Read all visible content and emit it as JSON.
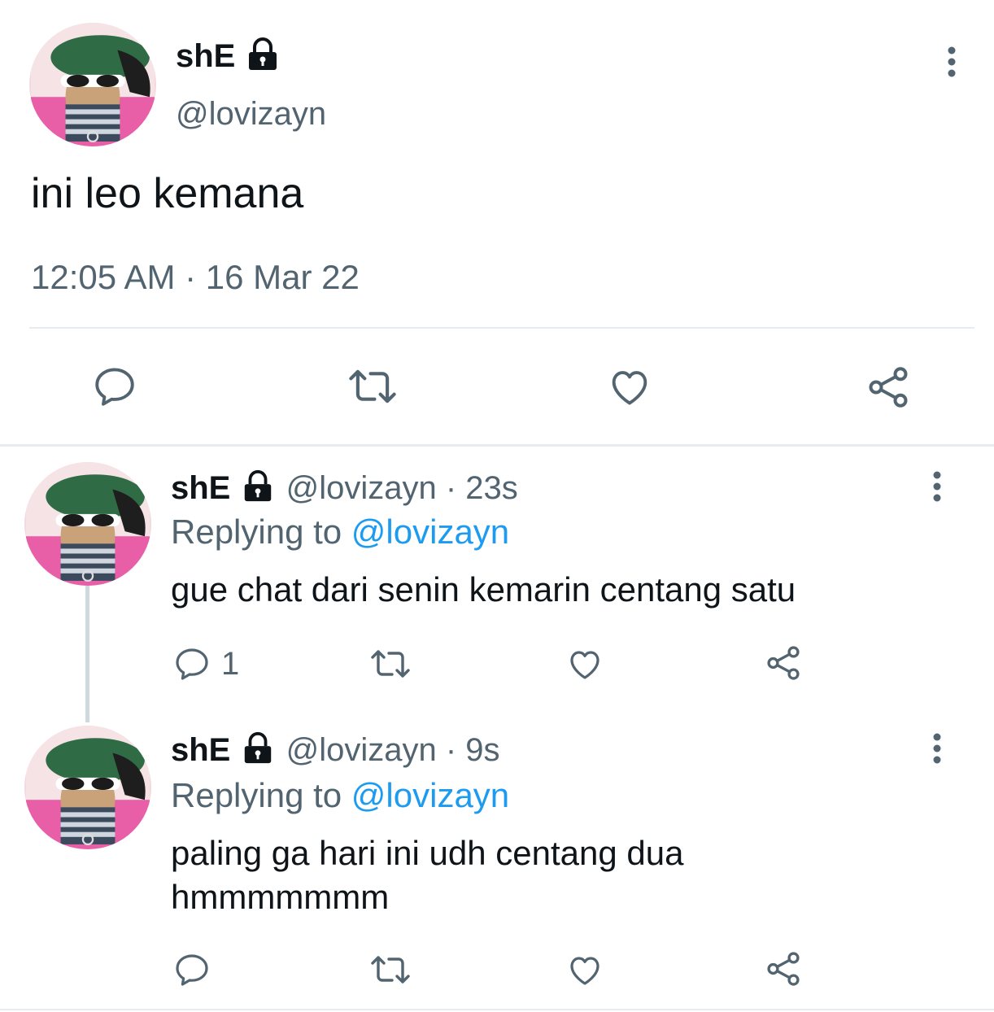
{
  "main_tweet": {
    "display_name": "shE",
    "handle": "@lovizayn",
    "text": "ini leo kemana",
    "timestamp": "12:05 AM · 16 Mar 22",
    "actions": [
      "reply-icon",
      "retweet-icon",
      "like-icon",
      "share-icon"
    ]
  },
  "replies": [
    {
      "display_name": "shE",
      "handle": "@lovizayn",
      "age": "· 23s",
      "replying_prefix": "Replying to",
      "replying_handle": "@lovizayn",
      "text": "gue chat dari senin kemarin centang satu",
      "reply_count": "1"
    },
    {
      "display_name": "shE",
      "handle": "@lovizayn",
      "age": "· 9s",
      "replying_prefix": "Replying to",
      "replying_handle": "@lovizayn",
      "text_line1": "paling ga hari ini udh centang dua",
      "text_line2": "hmmmmmmm",
      "reply_count": ""
    }
  ],
  "colors": {
    "accent": "#1d9bf0",
    "muted": "#536471",
    "text": "#0f1419"
  }
}
